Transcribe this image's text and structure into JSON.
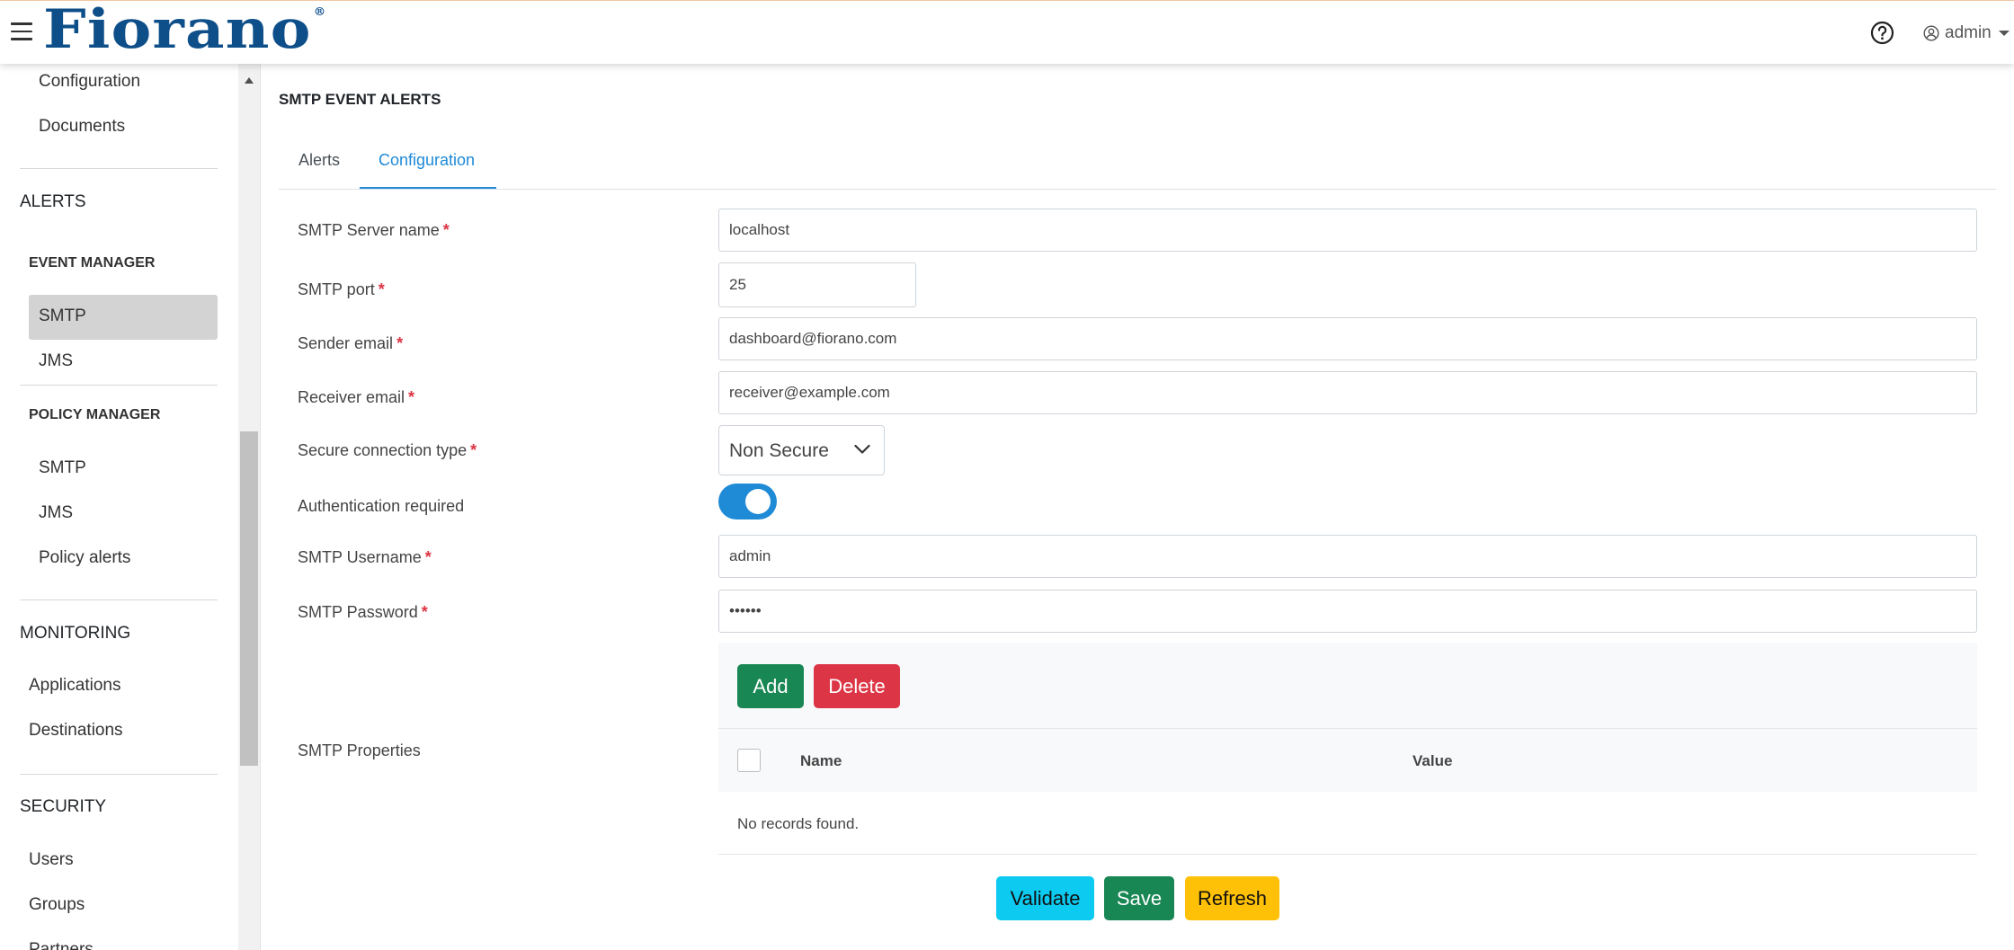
{
  "header": {
    "logo_text": "Fiorano",
    "logo_mark": "®",
    "user_label": "admin"
  },
  "sidebar": {
    "items_top": [
      "Configuration",
      "Documents"
    ],
    "alerts_heading": "ALERTS",
    "event_manager_heading": "EVENT MANAGER",
    "event_manager_items": [
      "SMTP",
      "JMS"
    ],
    "policy_manager_heading": "POLICY MANAGER",
    "policy_manager_items": [
      "SMTP",
      "JMS",
      "Policy alerts"
    ],
    "monitoring_heading": "MONITORING",
    "monitoring_items": [
      "Applications",
      "Destinations"
    ],
    "security_heading": "SECURITY",
    "security_items": [
      "Users",
      "Groups",
      "Partners"
    ]
  },
  "page": {
    "title": "SMTP EVENT ALERTS",
    "tabs": [
      "Alerts",
      "Configuration"
    ],
    "active_tab": "Configuration"
  },
  "form": {
    "server_name_label": "SMTP Server name",
    "server_name_value": "localhost",
    "port_label": "SMTP port",
    "port_value": "25",
    "sender_label": "Sender email",
    "sender_value": "dashboard@fiorano.com",
    "receiver_label": "Receiver email",
    "receiver_value": "receiver@example.com",
    "secure_label": "Secure connection type",
    "secure_value": "Non Secure",
    "auth_label": "Authentication required",
    "auth_enabled": true,
    "username_label": "SMTP Username",
    "username_value": "admin",
    "password_label": "SMTP Password",
    "password_value": "••••••",
    "required_mark": "*"
  },
  "properties": {
    "label": "SMTP Properties",
    "add_label": "Add",
    "delete_label": "Delete",
    "col_name": "Name",
    "col_value": "Value",
    "empty_text": "No records found."
  },
  "actions": {
    "validate_label": "Validate",
    "save_label": "Save",
    "refresh_label": "Refresh"
  },
  "colors": {
    "accent": "#1f8ad6",
    "logo": "#0e4f8a",
    "add": "#198754",
    "delete": "#dc3545",
    "validate": "#0dcaf0",
    "save": "#198754",
    "refresh": "#ffc107",
    "required": "#dc3545"
  },
  "icons": {
    "menu": "hamburger-icon",
    "help": "help-circle-icon",
    "user": "user-circle-icon",
    "select": "chevron-down-icon"
  }
}
